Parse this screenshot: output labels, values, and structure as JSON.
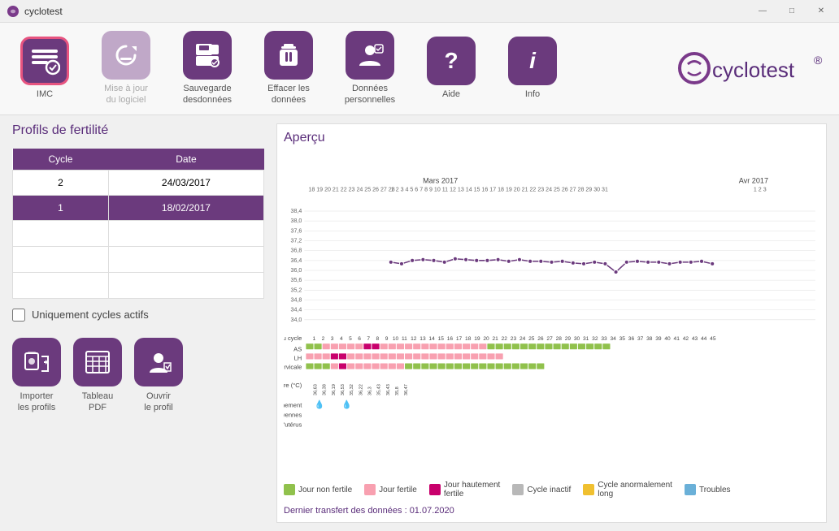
{
  "window": {
    "title": "cyclotest",
    "controls": {
      "minimize": "—",
      "maximize": "□",
      "close": "✕"
    }
  },
  "toolbar": {
    "items": [
      {
        "id": "imc",
        "label": "IMC",
        "icon": "imc",
        "selected": true,
        "disabled": false
      },
      {
        "id": "mise-a-jour",
        "label": "Mise à jour\ndu logiciel",
        "icon": "update",
        "selected": false,
        "disabled": true
      },
      {
        "id": "sauvegarde",
        "label": "Sauvegarde\ndesdonnées",
        "icon": "save",
        "selected": false,
        "disabled": false
      },
      {
        "id": "effacer",
        "label": "Effacer les\ndonnées",
        "icon": "delete",
        "selected": false,
        "disabled": false
      },
      {
        "id": "donnees",
        "label": "Données\npersonnelles",
        "icon": "person",
        "selected": false,
        "disabled": false
      },
      {
        "id": "aide",
        "label": "Aide",
        "icon": "help",
        "selected": false,
        "disabled": false
      },
      {
        "id": "info",
        "label": "Info",
        "icon": "info",
        "selected": false,
        "disabled": false
      }
    ],
    "brand": "cyclotest"
  },
  "left_panel": {
    "title": "Profils de fertilité",
    "table": {
      "headers": [
        "Cycle",
        "Date"
      ],
      "rows": [
        {
          "cycle": "2",
          "date": "24/03/2017",
          "selected": false
        },
        {
          "cycle": "1",
          "date": "18/02/2017",
          "selected": true
        },
        {
          "cycle": "",
          "date": "",
          "selected": false
        },
        {
          "cycle": "",
          "date": "",
          "selected": false
        },
        {
          "cycle": "",
          "date": "",
          "selected": false
        }
      ]
    },
    "checkbox": {
      "label": "Uniquement cycles actifs",
      "checked": false
    },
    "buttons": [
      {
        "id": "import",
        "label": "Importer\nles profils",
        "icon": "import"
      },
      {
        "id": "tableau",
        "label": "Tableau\nPDF",
        "icon": "tableau"
      },
      {
        "id": "ouvrir",
        "label": "Ouvrir\nle profil",
        "icon": "ouvrir"
      }
    ]
  },
  "right_panel": {
    "title": "Aperçu",
    "months": [
      "Mars 2017",
      "Avr 2017"
    ],
    "temperature_range": {
      "min": 34.0,
      "max": 38.4
    },
    "legend": [
      {
        "label": "Jour non fertile",
        "color": "#90c14c"
      },
      {
        "label": "Jour fertile",
        "color": "#f8a0b0"
      },
      {
        "label": "Jour hautement\nfertile",
        "color": "#c8006c"
      },
      {
        "label": "Cycle inactif",
        "color": "#b8b8b8"
      },
      {
        "label": "Cycle anormalement\nlong",
        "color": "#f0c030"
      },
      {
        "label": "Troubles",
        "color": "#6ab0d8"
      }
    ],
    "transfer_text": "Dernier transfert des données : 01.07.2020"
  }
}
